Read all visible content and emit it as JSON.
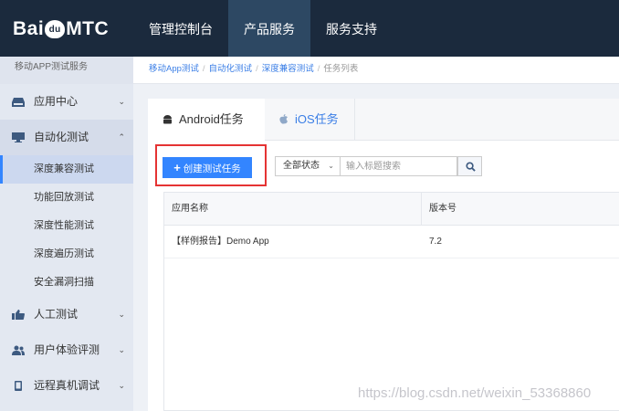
{
  "header": {
    "logo_pre": "Bai",
    "logo_mid": "du",
    "logo_post": "MTC",
    "nav": [
      {
        "label": "管理控制台"
      },
      {
        "label": "产品服务"
      },
      {
        "label": "服务支持"
      }
    ]
  },
  "sidebar": {
    "title": "移动APP测试服务",
    "items": [
      {
        "label": "应用中心",
        "icon": "drive-icon"
      },
      {
        "label": "自动化测试",
        "icon": "monitor-icon"
      },
      {
        "label": "人工测试",
        "icon": "thumbs-up-icon"
      },
      {
        "label": "用户体验评测",
        "icon": "users-icon"
      },
      {
        "label": "远程真机调试",
        "icon": "phone-icon"
      }
    ],
    "sub_items": [
      {
        "label": "深度兼容测试"
      },
      {
        "label": "功能回放测试"
      },
      {
        "label": "深度性能测试"
      },
      {
        "label": "深度遍历测试"
      },
      {
        "label": "安全漏洞扫描"
      }
    ]
  },
  "breadcrumb": {
    "items": [
      "移动App测试",
      "自动化测试",
      "深度兼容测试"
    ],
    "current": "任务列表"
  },
  "tabs": [
    {
      "label": "Android任务",
      "icon": "android-icon"
    },
    {
      "label": "iOS任务",
      "icon": "apple-icon"
    }
  ],
  "toolbar": {
    "create_label": "创建测试任务",
    "status_filter": "全部状态",
    "search_placeholder": "输入标题搜索"
  },
  "table": {
    "columns": [
      "应用名称",
      "版本号"
    ],
    "rows": [
      {
        "name": "【样例报告】Demo App",
        "version": "7.2"
      }
    ]
  },
  "watermark": "https://blog.csdn.net/weixin_53368860",
  "colors": {
    "accent": "#3385ff",
    "header": "#1b2a3d",
    "highlight": "#e53333"
  }
}
